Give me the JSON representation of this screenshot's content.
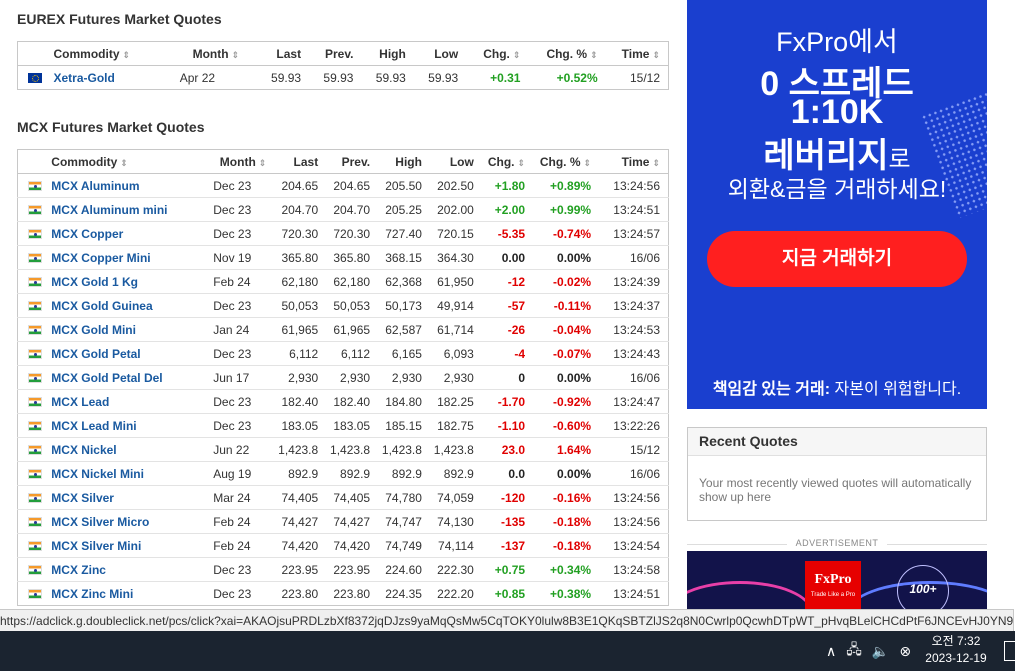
{
  "eurex": {
    "title": "EUREX Futures Market Quotes",
    "headers": [
      "Commodity",
      "Month",
      "Last",
      "Prev.",
      "High",
      "Low",
      "Chg.",
      "Chg. %",
      "Time"
    ],
    "rows": [
      {
        "name": "Xetra-Gold",
        "month": "Apr 22",
        "last": "59.93",
        "prev": "59.93",
        "high": "59.93",
        "low": "59.93",
        "chg": "+0.31",
        "pct": "+0.52%",
        "time": "15/12",
        "dir": "pos",
        "flag": "eu"
      }
    ]
  },
  "mcx": {
    "title": "MCX Futures Market Quotes",
    "headers": [
      "Commodity",
      "Month",
      "Last",
      "Prev.",
      "High",
      "Low",
      "Chg.",
      "Chg. %",
      "Time"
    ],
    "rows": [
      {
        "name": "MCX Aluminum",
        "month": "Dec 23",
        "last": "204.65",
        "prev": "204.65",
        "high": "205.50",
        "low": "202.50",
        "chg": "+1.80",
        "pct": "+0.89%",
        "time": "13:24:56",
        "dir": "pos"
      },
      {
        "name": "MCX Aluminum mini",
        "month": "Dec 23",
        "last": "204.70",
        "prev": "204.70",
        "high": "205.25",
        "low": "202.00",
        "chg": "+2.00",
        "pct": "+0.99%",
        "time": "13:24:51",
        "dir": "pos"
      },
      {
        "name": "MCX Copper",
        "month": "Dec 23",
        "last": "720.30",
        "prev": "720.30",
        "high": "727.40",
        "low": "720.15",
        "chg": "-5.35",
        "pct": "-0.74%",
        "time": "13:24:57",
        "dir": "neg"
      },
      {
        "name": "MCX Copper Mini",
        "month": "Nov 19",
        "last": "365.80",
        "prev": "365.80",
        "high": "368.15",
        "low": "364.30",
        "chg": "0.00",
        "pct": "0.00%",
        "time": "16/06",
        "dir": "zero"
      },
      {
        "name": "MCX Gold 1 Kg",
        "month": "Feb 24",
        "last": "62,180",
        "prev": "62,180",
        "high": "62,368",
        "low": "61,950",
        "chg": "-12",
        "pct": "-0.02%",
        "time": "13:24:39",
        "dir": "neg"
      },
      {
        "name": "MCX Gold Guinea",
        "month": "Dec 23",
        "last": "50,053",
        "prev": "50,053",
        "high": "50,173",
        "low": "49,914",
        "chg": "-57",
        "pct": "-0.11%",
        "time": "13:24:37",
        "dir": "neg"
      },
      {
        "name": "MCX Gold Mini",
        "month": "Jan 24",
        "last": "61,965",
        "prev": "61,965",
        "high": "62,587",
        "low": "61,714",
        "chg": "-26",
        "pct": "-0.04%",
        "time": "13:24:53",
        "dir": "neg"
      },
      {
        "name": "MCX Gold Petal",
        "month": "Dec 23",
        "last": "6,112",
        "prev": "6,112",
        "high": "6,165",
        "low": "6,093",
        "chg": "-4",
        "pct": "-0.07%",
        "time": "13:24:43",
        "dir": "neg"
      },
      {
        "name": "MCX Gold Petal Del",
        "month": "Jun 17",
        "last": "2,930",
        "prev": "2,930",
        "high": "2,930",
        "low": "2,930",
        "chg": "0",
        "pct": "0.00%",
        "time": "16/06",
        "dir": "zero"
      },
      {
        "name": "MCX Lead",
        "month": "Dec 23",
        "last": "182.40",
        "prev": "182.40",
        "high": "184.80",
        "low": "182.25",
        "chg": "-1.70",
        "pct": "-0.92%",
        "time": "13:24:47",
        "dir": "neg"
      },
      {
        "name": "MCX Lead Mini",
        "month": "Dec 23",
        "last": "183.05",
        "prev": "183.05",
        "high": "185.15",
        "low": "182.75",
        "chg": "-1.10",
        "pct": "-0.60%",
        "time": "13:22:26",
        "dir": "neg"
      },
      {
        "name": "MCX Nickel",
        "month": "Jun 22",
        "last": "1,423.8",
        "prev": "1,423.8",
        "high": "1,423.8",
        "low": "1,423.8",
        "chg": "23.0",
        "pct": "1.64%",
        "time": "15/12",
        "dir": "neg"
      },
      {
        "name": "MCX Nickel Mini",
        "month": "Aug 19",
        "last": "892.9",
        "prev": "892.9",
        "high": "892.9",
        "low": "892.9",
        "chg": "0.0",
        "pct": "0.00%",
        "time": "16/06",
        "dir": "zero"
      },
      {
        "name": "MCX Silver",
        "month": "Mar 24",
        "last": "74,405",
        "prev": "74,405",
        "high": "74,780",
        "low": "74,059",
        "chg": "-120",
        "pct": "-0.16%",
        "time": "13:24:56",
        "dir": "neg"
      },
      {
        "name": "MCX Silver Micro",
        "month": "Feb 24",
        "last": "74,427",
        "prev": "74,427",
        "high": "74,747",
        "low": "74,130",
        "chg": "-135",
        "pct": "-0.18%",
        "time": "13:24:56",
        "dir": "neg"
      },
      {
        "name": "MCX Silver Mini",
        "month": "Feb 24",
        "last": "74,420",
        "prev": "74,420",
        "high": "74,749",
        "low": "74,114",
        "chg": "-137",
        "pct": "-0.18%",
        "time": "13:24:54",
        "dir": "neg"
      },
      {
        "name": "MCX Zinc",
        "month": "Dec 23",
        "last": "223.95",
        "prev": "223.95",
        "high": "224.60",
        "low": "222.30",
        "chg": "+0.75",
        "pct": "+0.34%",
        "time": "13:24:58",
        "dir": "pos"
      },
      {
        "name": "MCX Zinc Mini",
        "month": "Dec 23",
        "last": "223.80",
        "prev": "223.80",
        "high": "224.35",
        "low": "222.20",
        "chg": "+0.85",
        "pct": "+0.38%",
        "time": "13:24:51",
        "dir": "pos"
      }
    ]
  },
  "ad": {
    "line1": "FxPro에서",
    "line2": "0 스프레드",
    "line3": "1:10K",
    "line4a": "레버리지",
    "line4b": "로",
    "line5": "외환&금을 거래하세요!",
    "cta": "지금 거래하기",
    "risk_bold": "책임감 있는 거래:",
    "risk_text": " 자본이 위험합니다.",
    "bg_color": "#1a3fcf",
    "cta_color": "#ff1f1f"
  },
  "recent": {
    "title": "Recent Quotes",
    "body": "Your most recently viewed quotes will automatically show up here"
  },
  "advertisement_label": "ADVERTISEMENT",
  "ad2": {
    "brand": "FxPro",
    "tagline": "Trade Like a Pro",
    "award": "100+"
  },
  "status_url": "https://adclick.g.doubleclick.net/pcs/click?xai=AKAOjsuPRDLzbXf8372jqDJzs9yaMqQsMw5CqTOKY0lulw8B3E1QKqSBTZlJS2q8N0Cwrlp0QcwhDTpWT_pHvqBLelCHCdPtF6JNCEvHJ0YN9O7Q...",
  "taskbar": {
    "time": "오전 7:32",
    "date": "2023-12-19"
  }
}
